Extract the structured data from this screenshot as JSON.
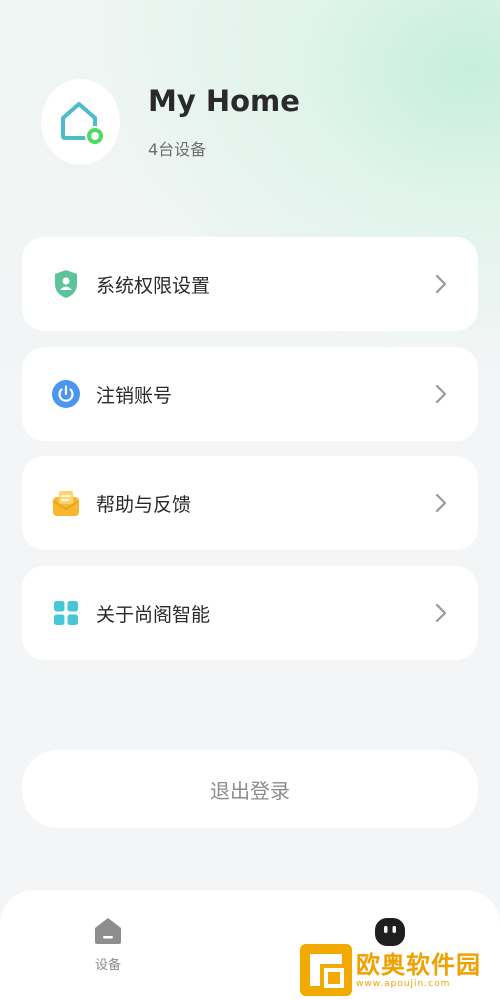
{
  "home": {
    "name": "My Home",
    "device_count": "4台设备"
  },
  "menu": [
    {
      "label": "系统权限设置",
      "icon": "shield-user-icon",
      "color": "#5cc39a"
    },
    {
      "label": "注销账号",
      "icon": "power-icon",
      "color": "#4a96f0"
    },
    {
      "label": "帮助与反馈",
      "icon": "feedback-mailbox-icon",
      "color": "#f7b731"
    },
    {
      "label": "关于尚阁智能",
      "icon": "grid-icon",
      "color": "#47c6d6"
    }
  ],
  "logout": {
    "label": "退出登录"
  },
  "tabbar": {
    "device_label": "设备"
  },
  "watermark": {
    "name": "欧奥软件园",
    "url": "www.apoujin.com"
  },
  "colors": {
    "accent_green": "#5cc39a",
    "home_icon_teal": "#4bbcc8",
    "status_dot": "#4cd964"
  }
}
